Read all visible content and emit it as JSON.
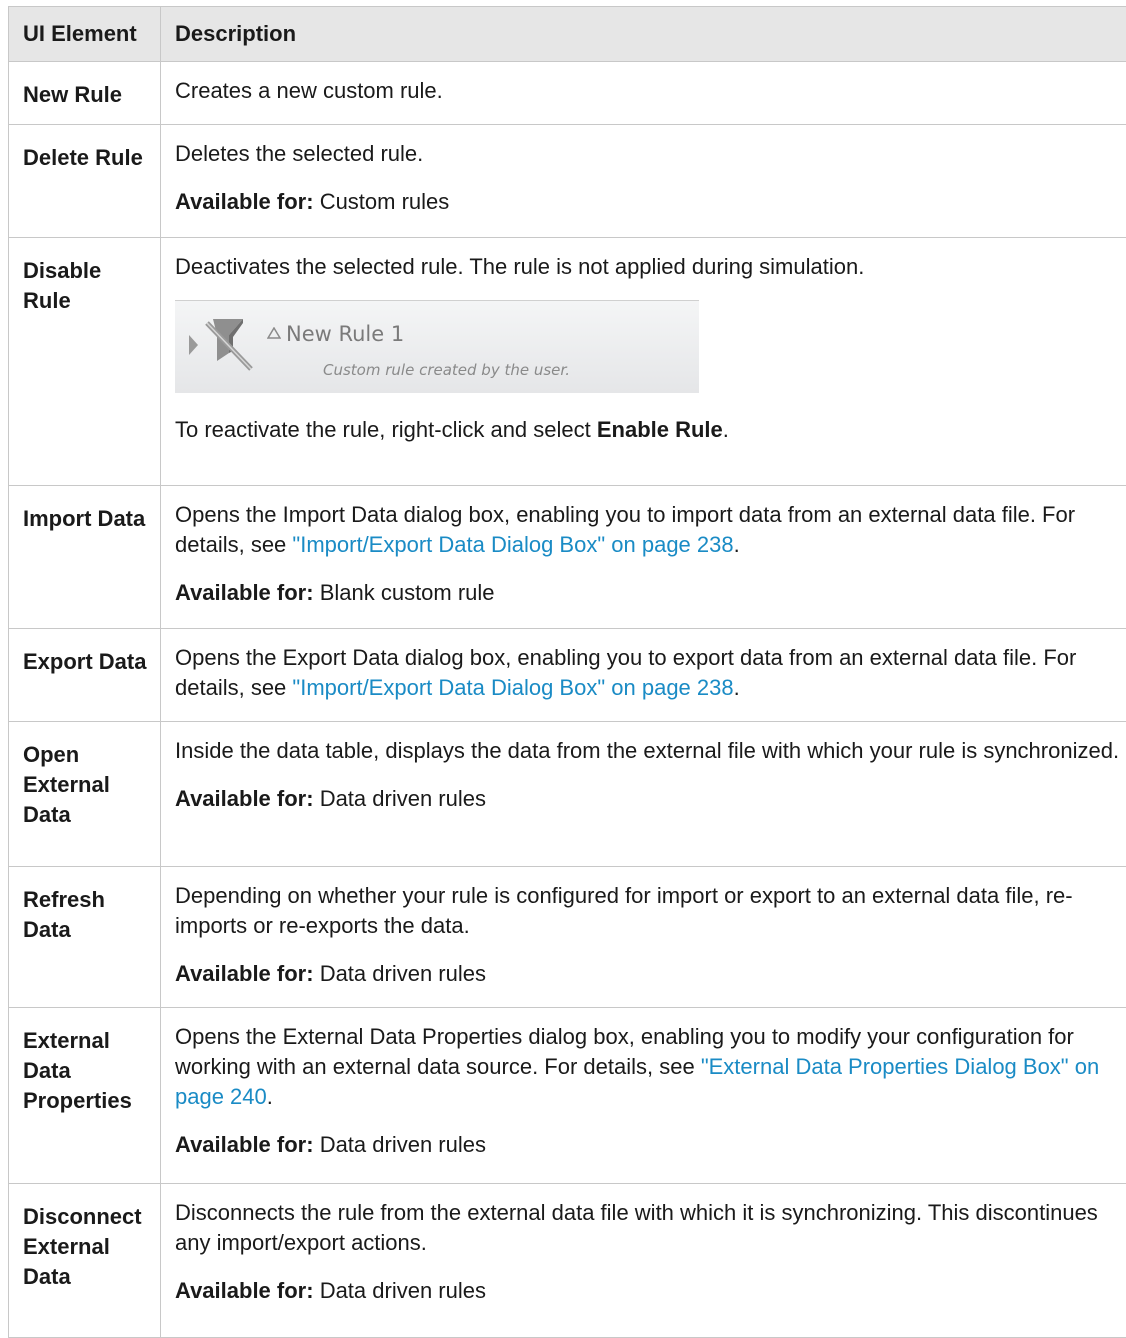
{
  "header": {
    "ui_element": "UI Element",
    "description": "Description"
  },
  "available_label": "Available for:",
  "rows": {
    "new_rule": {
      "name": "New Rule",
      "desc": "Creates a new custom rule."
    },
    "delete_rule": {
      "name": "Delete Rule",
      "desc": "Deletes the selected rule.",
      "available": "Custom rules"
    },
    "disable_rule": {
      "name": "Disable Rule",
      "desc": "Deactivates the selected rule. The rule is not applied during simulation.",
      "preview": {
        "rule_name": "New Rule 1",
        "rule_desc": "Custom rule created by the user."
      },
      "note_before": "To reactivate the rule, right-click and select ",
      "note_term": "Enable Rule",
      "note_after": "."
    },
    "import_data": {
      "name": "Import Data",
      "desc_before": "Opens the Import Data dialog box, enabling you to import data from an external data file. For details, see ",
      "link": "\"Import/Export Data Dialog Box\" on page 238",
      "desc_after": ".",
      "available": "Blank custom rule"
    },
    "export_data": {
      "name": "Export Data",
      "desc_before": "Opens the Export Data dialog box, enabling you to export data from an external data file. For details, see ",
      "link": "\"Import/Export Data Dialog Box\" on page 238",
      "desc_after": "."
    },
    "open_external_data": {
      "name": "Open External Data",
      "desc": "Inside the data table, displays the data from the external file with which your rule is synchronized.",
      "available": "Data driven rules"
    },
    "refresh_data": {
      "name": "Refresh Data",
      "desc": "Depending on whether your rule is configured for import or export to an external data file, re-imports or re-exports the data.",
      "available": "Data driven rules"
    },
    "external_data_properties": {
      "name": "External Data Properties",
      "desc_before": "Opens the External Data Properties dialog box, enabling you to modify your configuration for working with an external data source. For details, see ",
      "link": "\"External Data Properties Dialog Box\" on page 240",
      "desc_after": ".",
      "available": "Data driven rules"
    },
    "disconnect_external_data": {
      "name": "Disconnect External Data",
      "desc": "Disconnects the rule from the external data file with which it is synchronizing. This discontinues any import/export actions.",
      "available": "Data driven rules"
    }
  }
}
